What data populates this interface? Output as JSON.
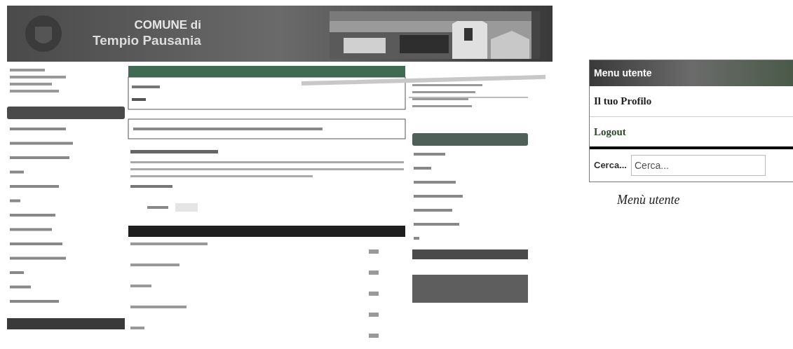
{
  "site_header": {
    "line_1": "COMUNE di",
    "line_2": "Tempio Pausania",
    "kind": "picture"
  },
  "user_menu_inset": {
    "title": "Menu utente",
    "items": [
      {
        "label": "Il tuo Profilo",
        "kind": "plain"
      },
      {
        "label": "Logout",
        "kind": "accent"
      }
    ],
    "search": {
      "label": "Cerca...",
      "placeholder": "Cerca..."
    }
  },
  "caption": "Menù utente"
}
